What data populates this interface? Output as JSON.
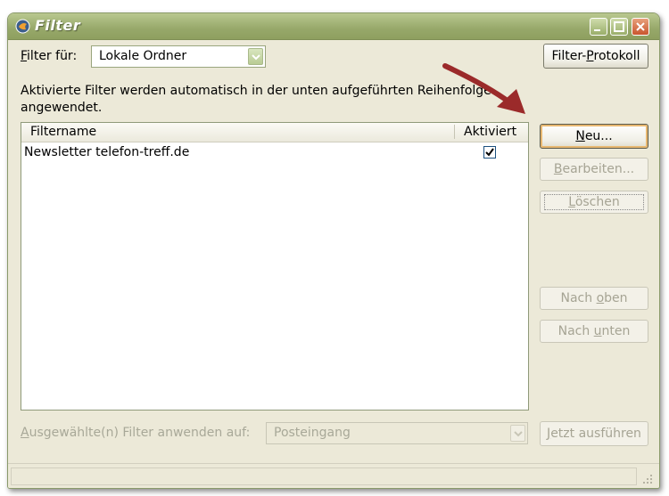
{
  "window": {
    "title": "Filter"
  },
  "filter_for": {
    "label_prefix": "F",
    "label_rest": "ilter für:",
    "selected": "Lokale Ordner"
  },
  "buttons": {
    "filter_log_pre": "Filter-",
    "filter_log_u": "P",
    "filter_log_post": "rotokoll",
    "new_u": "N",
    "new_rest": "eu...",
    "edit_u": "B",
    "edit_rest": "earbeiten...",
    "delete_u": "L",
    "delete_rest": "öschen",
    "up_pre": "Nach ",
    "up_u": "o",
    "up_post": "ben",
    "down_pre": "Nach ",
    "down_u": "u",
    "down_post": "nten",
    "run_u": "J",
    "run_rest": "etzt ausführen"
  },
  "info_text_line1": "Aktivierte Filter werden automatisch in der unten aufgeführten Reihenfolge",
  "info_text_line2": "angewendet.",
  "list": {
    "col_name": "Filtername",
    "col_active": "Aktiviert",
    "rows": [
      {
        "name": "Newsletter telefon-treff.de",
        "active": true
      }
    ]
  },
  "apply": {
    "label_u": "A",
    "label_rest": "usgewählte(n) Filter anwenden auf:",
    "selected": "Posteingang"
  },
  "colors": {
    "titlebar": "#97a86a",
    "window_bg": "#ece9d8",
    "annotation_arrow": "#9b2a2a"
  }
}
